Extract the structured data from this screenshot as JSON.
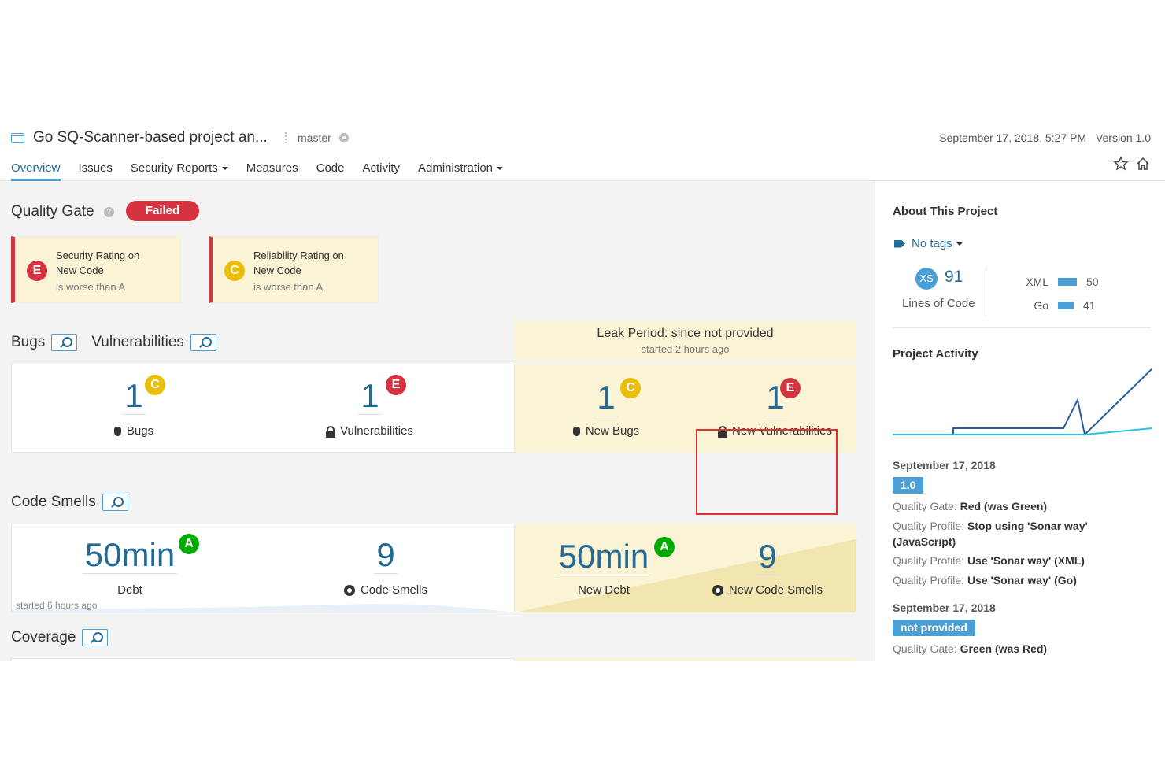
{
  "header": {
    "project_name": "Go SQ-Scanner-based project an...",
    "branch": "master",
    "analysis_date": "September 17, 2018, 5:27 PM",
    "version": "Version 1.0",
    "nav": [
      {
        "label": "Overview",
        "active": true
      },
      {
        "label": "Issues"
      },
      {
        "label": "Security Reports",
        "dropdown": true
      },
      {
        "label": "Measures"
      },
      {
        "label": "Code"
      },
      {
        "label": "Activity"
      },
      {
        "label": "Administration",
        "dropdown": true
      }
    ]
  },
  "quality_gate": {
    "title": "Quality Gate",
    "status": "Failed",
    "conditions": [
      {
        "rating": "E",
        "line1": "Security Rating on",
        "line2": "New Code",
        "sub": "is worse than A"
      },
      {
        "rating": "C",
        "line1": "Reliability Rating on",
        "line2": "New Code",
        "sub": "is worse than A"
      }
    ]
  },
  "bugs_vulns": {
    "title_bugs": "Bugs",
    "title_vulns": "Vulnerabilities",
    "leak_title": "Leak Period: since not provided",
    "leak_sub": "started 2 hours ago",
    "bugs": {
      "value": "1",
      "rating": "C",
      "label": "Bugs"
    },
    "vulns": {
      "value": "1",
      "rating": "E",
      "label": "Vulnerabilities"
    },
    "new_bugs": {
      "value": "1",
      "rating": "C",
      "label": "New Bugs"
    },
    "new_vulns": {
      "value": "1",
      "rating": "E",
      "label": "New Vulnerabilities"
    }
  },
  "code_smells": {
    "title": "Code Smells",
    "debt": {
      "value": "50min",
      "rating": "A",
      "label": "Debt"
    },
    "smells": {
      "value": "9",
      "label": "Code Smells"
    },
    "new_debt": {
      "value": "50min",
      "rating": "A",
      "label": "New Debt"
    },
    "new_smells": {
      "value": "9",
      "label": "New Code Smells"
    },
    "started": "started 6 hours ago"
  },
  "coverage": {
    "title": "Coverage"
  },
  "sidebar": {
    "about_title": "About This Project",
    "tags": "No tags",
    "size_badge": "XS",
    "lines_of_code": "91",
    "lines_label": "Lines of Code",
    "languages": [
      {
        "name": "XML",
        "value": "50"
      },
      {
        "name": "Go",
        "value": "41"
      }
    ],
    "activity_title": "Project Activity",
    "activity": [
      {
        "date": "September 17, 2018",
        "badge": "1.0",
        "events": [
          {
            "key": "Quality Gate:",
            "value": "Red (was Green)"
          },
          {
            "key": "Quality Profile:",
            "value": "Stop using 'Sonar way' (JavaScript)"
          },
          {
            "key": "Quality Profile:",
            "value": "Use 'Sonar way' (XML)"
          },
          {
            "key": "Quality Profile:",
            "value": "Use 'Sonar way' (Go)"
          }
        ]
      },
      {
        "date": "September 17, 2018",
        "badge": "not provided",
        "events": [
          {
            "key": "Quality Gate:",
            "value": "Green (was Red)"
          }
        ]
      }
    ]
  },
  "colors": {
    "accent": "#4b9fd5",
    "link": "#236a97",
    "fail": "#d4333f",
    "leak": "#fbf3d5",
    "rating_c": "#eabe06",
    "rating_a": "#00aa00"
  }
}
